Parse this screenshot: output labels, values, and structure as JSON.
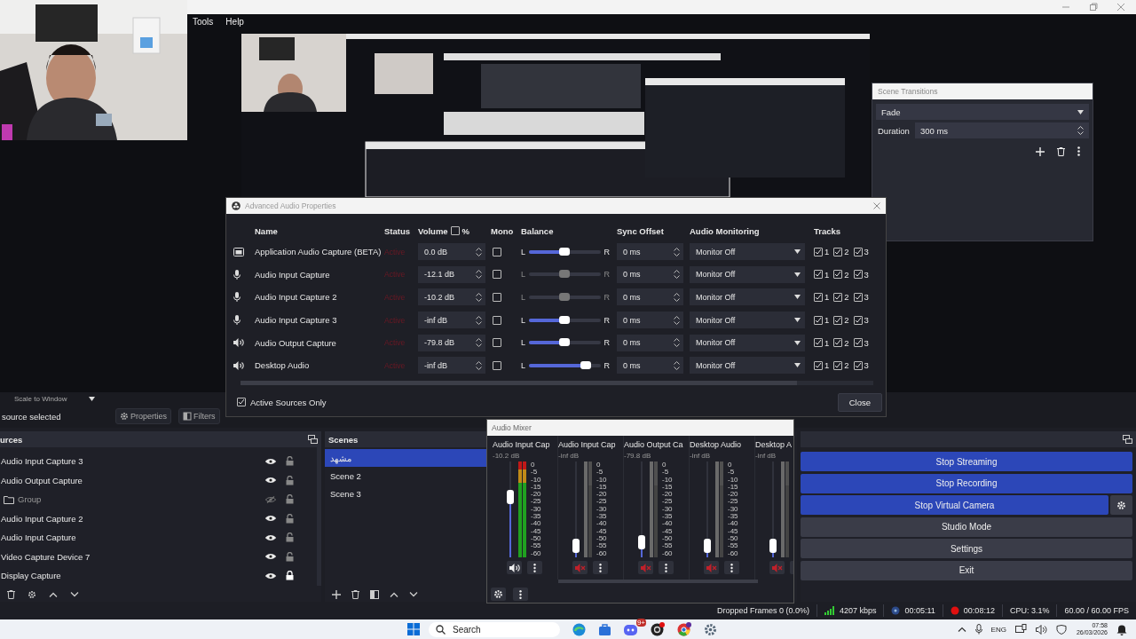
{
  "menu": [
    "Tools",
    "Help"
  ],
  "scene_transitions": {
    "title": "Scene Transitions",
    "transition": "Fade",
    "duration_label": "Duration",
    "duration": "300 ms"
  },
  "preview_bar": {
    "scale": "Scale to Window"
  },
  "source_toolbar": {
    "label": "source selected",
    "buttons": [
      "Properties",
      "Filters"
    ]
  },
  "sources": {
    "title": "urces",
    "items": [
      {
        "name": "Audio Input Capture 3",
        "kind": "source",
        "visible": true,
        "locked": false
      },
      {
        "name": "Audio Output Capture",
        "kind": "source",
        "visible": true,
        "locked": false
      },
      {
        "name": "Group",
        "kind": "group",
        "visible": false,
        "locked": false
      },
      {
        "name": "Audio Input Capture 2",
        "kind": "source",
        "visible": true,
        "locked": false
      },
      {
        "name": "Audio Input Capture",
        "kind": "source",
        "visible": true,
        "locked": false
      },
      {
        "name": "Video Capture Device 7",
        "kind": "source",
        "visible": true,
        "locked": false
      },
      {
        "name": "Display Capture",
        "kind": "source",
        "visible": true,
        "locked": true
      }
    ]
  },
  "scenes": {
    "title": "Scenes",
    "items": [
      {
        "name": "مشهد",
        "selected": true
      },
      {
        "name": "Scene 2",
        "selected": false
      },
      {
        "name": "Scene 3",
        "selected": false
      }
    ]
  },
  "advanced_audio": {
    "title": "Advanced Audio Properties",
    "columns": [
      "Name",
      "Status",
      "Volume",
      "Mono",
      "Balance",
      "Sync Offset",
      "Audio Monitoring",
      "Tracks"
    ],
    "percent_label": "%",
    "percent_checked": false,
    "rows": [
      {
        "kind": "app",
        "name": "Application Audio Capture (BETA)",
        "status": "Active",
        "volume": "0.0 dB",
        "mono": false,
        "balance_enabled": true,
        "left": "L",
        "right": "R",
        "level": 0.5,
        "sync": "0 ms",
        "monitoring": "Monitor Off",
        "tracks": [
          {
            "label": "1",
            "checked": true
          },
          {
            "label": "2",
            "checked": true
          },
          {
            "label": "3",
            "checked": true
          }
        ]
      },
      {
        "kind": "mic",
        "name": "Audio Input Capture",
        "status": "Active",
        "volume": "-12.1 dB",
        "mono": false,
        "balance_enabled": false,
        "left": "L",
        "right": "R",
        "level": 0.5,
        "sync": "0 ms",
        "monitoring": "Monitor Off",
        "tracks": [
          {
            "label": "1",
            "checked": true
          },
          {
            "label": "2",
            "checked": true
          },
          {
            "label": "3",
            "checked": true
          }
        ]
      },
      {
        "kind": "mic",
        "name": "Audio Input Capture 2",
        "status": "Active",
        "volume": "-10.2 dB",
        "mono": false,
        "balance_enabled": false,
        "left": "L",
        "right": "R",
        "level": 0.5,
        "sync": "0 ms",
        "monitoring": "Monitor Off",
        "tracks": [
          {
            "label": "1",
            "checked": true
          },
          {
            "label": "2",
            "checked": true
          },
          {
            "label": "3",
            "checked": true
          }
        ]
      },
      {
        "kind": "mic",
        "name": "Audio Input Capture 3",
        "status": "Active",
        "volume": "-inf dB",
        "mono": false,
        "balance_enabled": true,
        "left": "L",
        "right": "R",
        "level": 0.5,
        "sync": "0 ms",
        "monitoring": "Monitor Off",
        "tracks": [
          {
            "label": "1",
            "checked": true
          },
          {
            "label": "2",
            "checked": true
          },
          {
            "label": "3",
            "checked": true
          }
        ]
      },
      {
        "kind": "speaker",
        "name": "Audio Output Capture",
        "status": "Active",
        "volume": "-79.8 dB",
        "mono": false,
        "balance_enabled": true,
        "left": "L",
        "right": "R",
        "level": 0.5,
        "sync": "0 ms",
        "monitoring": "Monitor Off",
        "tracks": [
          {
            "label": "1",
            "checked": true
          },
          {
            "label": "2",
            "checked": true
          },
          {
            "label": "3",
            "checked": true
          }
        ]
      },
      {
        "kind": "speaker",
        "name": "Desktop Audio",
        "status": "Active",
        "volume": "-inf dB",
        "mono": false,
        "balance_enabled": true,
        "left": "L",
        "right": "R",
        "level": 0.8,
        "sync": "0 ms",
        "monitoring": "Monitor Off",
        "tracks": [
          {
            "label": "1",
            "checked": true
          },
          {
            "label": "2",
            "checked": true
          },
          {
            "label": "3",
            "checked": true
          }
        ]
      }
    ],
    "active_only_label": "Active Sources Only",
    "active_only_checked": true,
    "close": "Close"
  },
  "audio_mixer": {
    "title": "Audio Mixer",
    "channels": [
      {
        "name": "Audio Input Cap",
        "reading": "-10.2 dB",
        "level": 0.65,
        "muted": false,
        "scale": [
          "0",
          "-5",
          "-10",
          "-15",
          "-20",
          "-25",
          "-30",
          "-35",
          "-40",
          "-45",
          "-50",
          "-55",
          "-60"
        ]
      },
      {
        "name": "Audio Input Cap",
        "reading": "-inf dB",
        "level": 0.05,
        "muted": true,
        "scale": [
          "0",
          "-5",
          "-10",
          "-15",
          "-20",
          "-25",
          "-30",
          "-35",
          "-40",
          "-45",
          "-50",
          "-55",
          "-60"
        ]
      },
      {
        "name": "Audio Output Ca",
        "reading": "-79.8 dB",
        "level": 0.1,
        "muted": true,
        "scale": [
          "0",
          "-5",
          "-10",
          "-15",
          "-20",
          "-25",
          "-30",
          "-35",
          "-40",
          "-45",
          "-50",
          "-55",
          "-60"
        ]
      },
      {
        "name": "Desktop Audio",
        "reading": "-inf dB",
        "level": 0.05,
        "muted": true,
        "scale": [
          "0",
          "-5",
          "-10",
          "-15",
          "-20",
          "-25",
          "-30",
          "-35",
          "-40",
          "-45",
          "-50",
          "-55",
          "-60"
        ]
      },
      {
        "name": "Desktop A",
        "reading": "-inf dB",
        "level": 0.05,
        "muted": true
      }
    ]
  },
  "controls": {
    "buttons": [
      {
        "label": "Stop Streaming",
        "active": true,
        "has_settings": false
      },
      {
        "label": "Stop Recording",
        "active": true,
        "has_settings": false
      },
      {
        "label": "Stop Virtual Camera",
        "active": true,
        "has_settings": true
      },
      {
        "label": "Studio Mode",
        "active": false,
        "has_settings": false
      },
      {
        "label": "Settings",
        "active": false,
        "has_settings": false
      },
      {
        "label": "Exit",
        "active": false,
        "has_settings": false
      }
    ]
  },
  "status_bar": {
    "dropped": "Dropped Frames 0 (0.0%)",
    "bitrate": "4207 kbps",
    "stream_time": "00:05:11",
    "record_time": "00:08:12",
    "cpu": "CPU: 3.1%",
    "fps": "60.00 / 60.00 FPS"
  },
  "taskbar": {
    "search": "Search",
    "badge": "9+",
    "language": "ENG",
    "time": "07:58",
    "date": "26/03/2026"
  }
}
